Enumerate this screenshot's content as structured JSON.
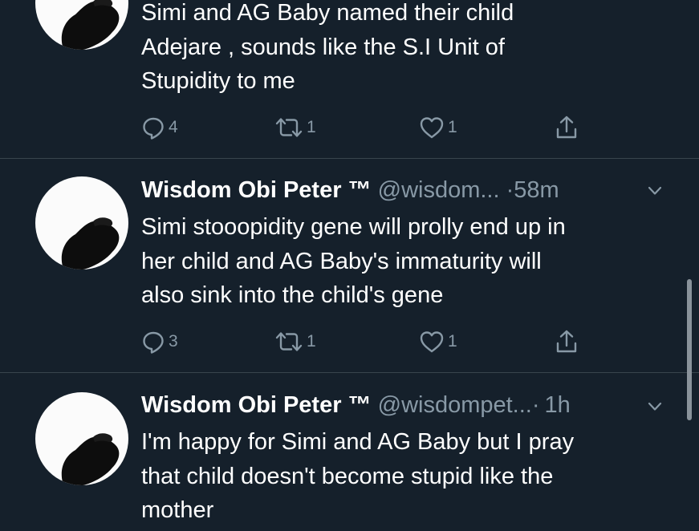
{
  "colors": {
    "background": "#15202b",
    "text_primary": "#ffffff",
    "text_secondary": "#8899a6",
    "divider": "#38444d"
  },
  "tweets": [
    {
      "text": "Simi and AG Baby named their child\nAdejare , sounds like the S.I Unit of\nStupidity to me",
      "replies": "4",
      "retweets": "1",
      "likes": "1",
      "icons": [
        "reply-icon",
        "retweet-icon",
        "like-icon",
        "share-icon"
      ]
    },
    {
      "name": "Wisdom Obi Peter ™",
      "handle": "@wisdom...",
      "separator": "·",
      "time": "58m",
      "text": "Simi stooopidity gene will prolly end up in\nher child and AG Baby's immaturity will\nalso sink into the child's gene",
      "replies": "3",
      "retweets": "1",
      "likes": "1",
      "icons": [
        "reply-icon",
        "retweet-icon",
        "like-icon",
        "share-icon"
      ]
    },
    {
      "name": "Wisdom Obi Peter ™",
      "handle": "@wisdompet...",
      "separator": "·",
      "time": "1h",
      "text": "I'm happy for Simi and AG Baby but I pray\nthat child doesn't become stupid like the\nmother"
    }
  ]
}
